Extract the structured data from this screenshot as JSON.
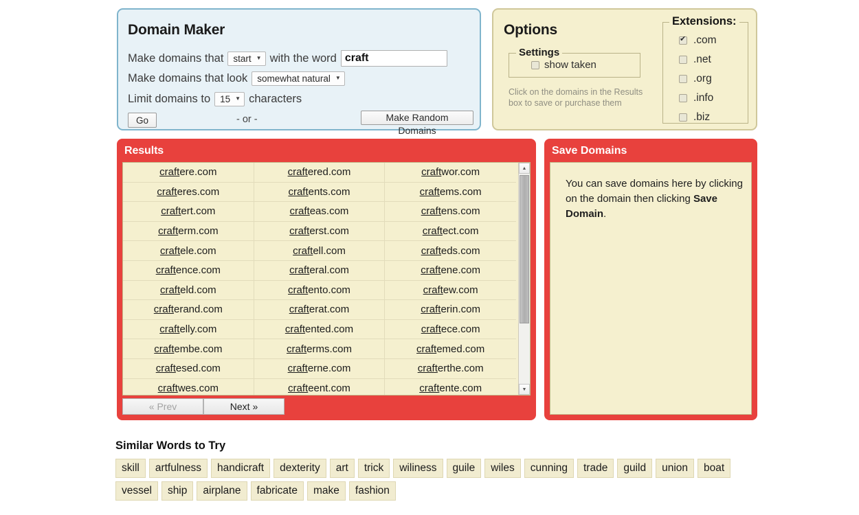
{
  "maker": {
    "title": "Domain Maker",
    "line1_prefix": "Make domains that",
    "position_select": "start",
    "line1_mid": "with the word",
    "word_value": "craft",
    "word_placeholder": "",
    "line2_prefix": "Make domains that look",
    "naturalness_select": "somewhat natural",
    "line3_prefix": "Limit domains to",
    "limit_select": "15",
    "line3_suffix": "characters",
    "go_label": "Go",
    "or_label": "- or -",
    "random_label": "Make Random Domains",
    "caret": "▼"
  },
  "options": {
    "title": "Options",
    "settings_legend": "Settings",
    "show_taken_label": "show taken",
    "show_taken_checked": false,
    "hint": "Click on the domains in the Results box to save or purchase them",
    "extensions_legend": "Extensions:",
    "extensions": [
      {
        "label": ".com",
        "checked": true
      },
      {
        "label": ".net",
        "checked": false
      },
      {
        "label": ".org",
        "checked": false
      },
      {
        "label": ".info",
        "checked": false
      },
      {
        "label": ".biz",
        "checked": false
      }
    ]
  },
  "results": {
    "title": "Results",
    "matched_word": "craft",
    "prev_label": "« Prev",
    "next_label": "Next »",
    "prev_disabled": true,
    "rows": [
      [
        "craftere.com",
        "craftered.com",
        "craftwor.com"
      ],
      [
        "crafteres.com",
        "craftents.com",
        "craftems.com"
      ],
      [
        "craftert.com",
        "crafteas.com",
        "craftens.com"
      ],
      [
        "crafterm.com",
        "crafterst.com",
        "craftect.com"
      ],
      [
        "craftele.com",
        "craftell.com",
        "crafteds.com"
      ],
      [
        "craftence.com",
        "crafteral.com",
        "craftene.com"
      ],
      [
        "crafteld.com",
        "craftento.com",
        "craftew.com"
      ],
      [
        "crafterand.com",
        "crafterat.com",
        "crafterin.com"
      ],
      [
        "craftelly.com",
        "craftented.com",
        "craftece.com"
      ],
      [
        "craftembe.com",
        "crafterms.com",
        "craftemed.com"
      ],
      [
        "craftesed.com",
        "crafterne.com",
        "crafterthe.com"
      ],
      [
        "craftwes.com",
        "crafteent.com",
        "craftente.com"
      ]
    ]
  },
  "save": {
    "title": "Save Domains",
    "text_before": "You can save domains here by clicking on the domain then clicking ",
    "text_bold": "Save Domain",
    "text_after": "."
  },
  "similar": {
    "title": "Similar Words to Try",
    "words": [
      "skill",
      "artfulness",
      "handicraft",
      "dexterity",
      "art",
      "trick",
      "wiliness",
      "guile",
      "wiles",
      "cunning",
      "trade",
      "guild",
      "union",
      "boat",
      "vessel",
      "ship",
      "airplane",
      "fabricate",
      "make",
      "fashion"
    ]
  },
  "colors": {
    "panel_red": "#e8413d",
    "cream": "#f5f0cf",
    "maker_blue": "#e8f2f7",
    "maker_border": "#7fb4cc"
  }
}
